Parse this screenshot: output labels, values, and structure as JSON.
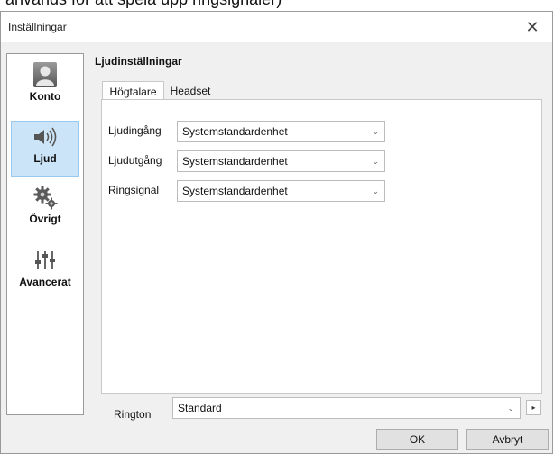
{
  "caption": "används för att spela upp ringsignaler)",
  "window": {
    "title": "Inställningar",
    "close_glyph": "✕"
  },
  "sidebar": {
    "items": [
      {
        "label": "Konto",
        "icon": "user-icon",
        "active": false
      },
      {
        "label": "Ljud",
        "icon": "speaker-icon",
        "active": true
      },
      {
        "label": "Övrigt",
        "icon": "gears-icon",
        "active": false
      },
      {
        "label": "Avancerat",
        "icon": "sliders-icon",
        "active": false
      }
    ]
  },
  "main": {
    "title": "Ljudinställningar",
    "tabs": [
      {
        "label": "Högtalare",
        "active": true
      },
      {
        "label": "Headset",
        "active": false
      }
    ],
    "rows": [
      {
        "label": "Ljudingång",
        "value": "Systemstandardenhet"
      },
      {
        "label": "Ljudutgång",
        "value": "Systemstandardenhet"
      },
      {
        "label": "Ringsignal",
        "value": "Systemstandardenhet"
      }
    ],
    "ringtone": {
      "label": "Rington",
      "value": "Standard"
    }
  },
  "footer": {
    "ok_label": "OK",
    "cancel_label": "Avbryt"
  },
  "colors": {
    "active_bg": "#cce4f7",
    "active_border": "#99c9ef",
    "dialog_bg": "#f0f0f0"
  }
}
